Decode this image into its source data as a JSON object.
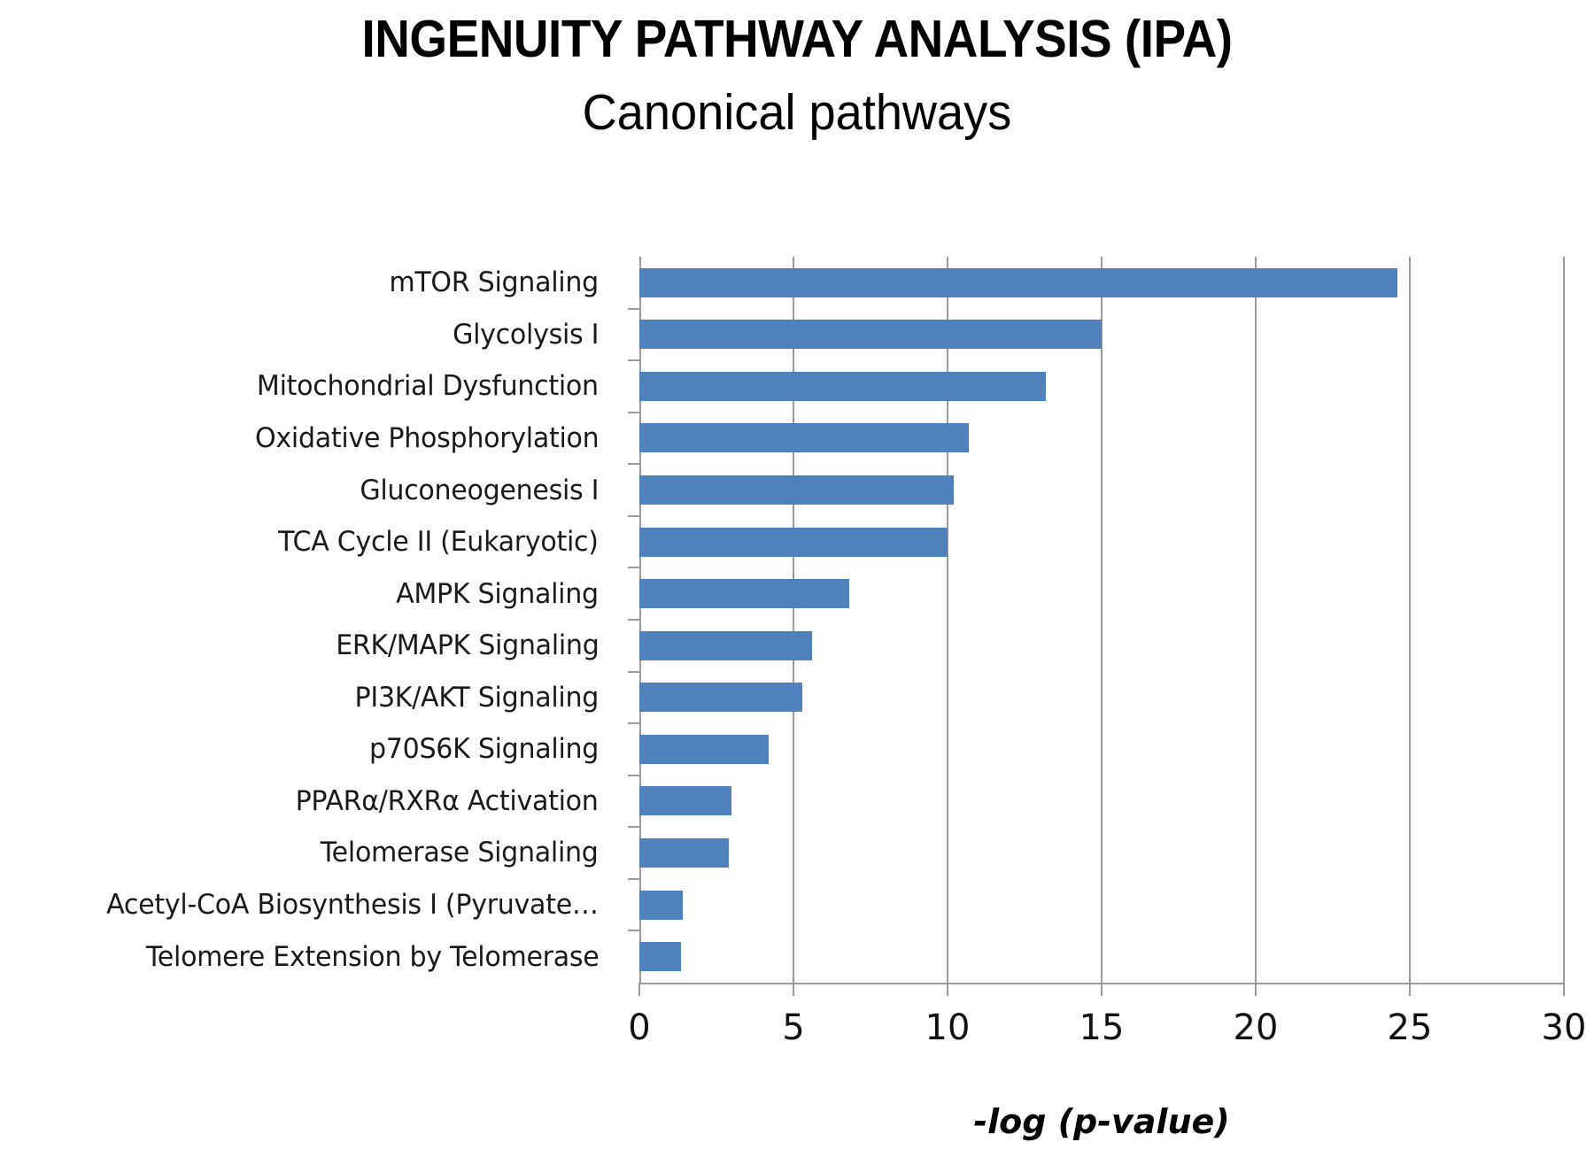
{
  "header": {
    "main_title": "INGENUITY PATHWAY ANALYSIS (IPA)",
    "subtitle": "Canonical pathways"
  },
  "chart_data": {
    "type": "bar",
    "orientation": "horizontal",
    "title": "INGENUITY PATHWAY ANALYSIS (IPA)",
    "subtitle": "Canonical pathways",
    "xlabel": "-log (p-value)",
    "ylabel": "",
    "xlim": [
      0,
      30
    ],
    "xticks": [
      0,
      5,
      10,
      15,
      20,
      25,
      30
    ],
    "xtick_labels": [
      "0",
      "5",
      "10",
      "15",
      "20",
      "25",
      "30"
    ],
    "grid": "vertical",
    "legend": "none",
    "bar_color": "#4f81bd",
    "categories": [
      "mTOR Signaling",
      "Glycolysis I",
      "Mitochondrial Dysfunction",
      "Oxidative Phosphorylation",
      "Gluconeogenesis I",
      "TCA Cycle II (Eukaryotic)",
      "AMPK Signaling",
      "ERK/MAPK Signaling",
      "PI3K/AKT Signaling",
      "p70S6K Signaling",
      "PPARα/RXRα Activation",
      "Telomerase Signaling",
      "Acetyl-CoA Biosynthesis I (Pyruvate…",
      "Telomere Extension by Telomerase"
    ],
    "values": [
      24.6,
      15.0,
      13.2,
      10.7,
      10.2,
      10.0,
      6.8,
      5.6,
      5.3,
      4.2,
      3.0,
      2.9,
      1.4,
      1.35
    ]
  }
}
